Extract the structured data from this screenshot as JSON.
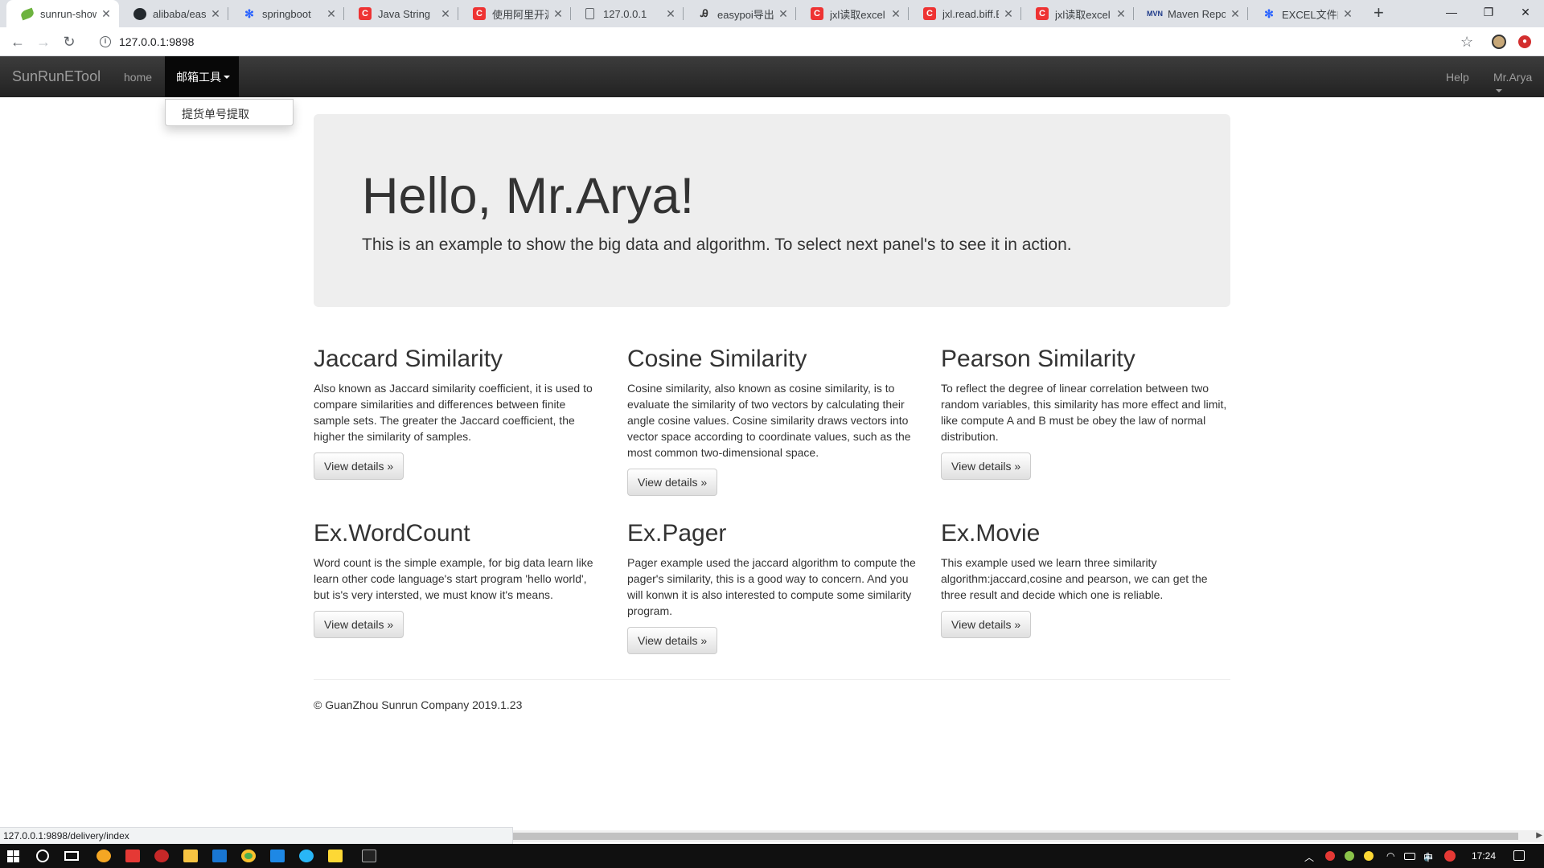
{
  "browser": {
    "tabs": [
      {
        "title": "sunrun-show",
        "icon": "spring-leaf-icon",
        "active": true
      },
      {
        "title": "alibaba/easy",
        "icon": "github-icon"
      },
      {
        "title": "springboot",
        "icon": "baidu-paw-icon"
      },
      {
        "title": "Java String",
        "icon": "csdn-icon"
      },
      {
        "title": "使用阿里开源",
        "icon": "csdn-icon"
      },
      {
        "title": "127.0.0.1",
        "icon": "document-icon"
      },
      {
        "title": "easypoi导出",
        "icon": "jianshu-icon"
      },
      {
        "title": "jxl读取excel",
        "icon": "csdn-icon"
      },
      {
        "title": "jxl.read.biff.B",
        "icon": "csdn-icon"
      },
      {
        "title": "jxl读取excel",
        "icon": "csdn-icon"
      },
      {
        "title": "Maven Repo",
        "icon": "maven-icon"
      },
      {
        "title": "EXCEL文件的",
        "icon": "baidu-paw-icon"
      }
    ],
    "url": "127.0.0.1:9898",
    "status_url": "127.0.0.1:9898/delivery/index"
  },
  "navbar": {
    "brand": "SunRunETool",
    "home": "home",
    "mail_tools": "邮箱工具",
    "help": "Help",
    "user": "Mr.Arya"
  },
  "dropdown": {
    "item": "提货单号提取"
  },
  "jumbotron": {
    "heading": "Hello, Mr.Arya!",
    "text": "This is an example to show the big data and algorithm. To select next panel's to see it in action."
  },
  "features": [
    {
      "title": "Jaccard Similarity",
      "text": "Also known as Jaccard similarity coefficient, it is used to compare similarities and differences between finite sample sets. The greater the Jaccard coefficient, the higher the similarity of samples.",
      "button": "View details »"
    },
    {
      "title": "Cosine Similarity",
      "text": "Cosine similarity, also known as cosine similarity, is to evaluate the similarity of two vectors by calculating their angle cosine values. Cosine similarity draws vectors into vector space according to coordinate values, such as the most common two-dimensional space.",
      "button": "View details »"
    },
    {
      "title": "Pearson Similarity",
      "text": "To reflect the degree of linear correlation between two random variables, this similarity has more effect and limit, like compute A and B must be obey the law of normal distribution.",
      "button": "View details »"
    },
    {
      "title": "Ex.WordCount",
      "text": "Word count is the simple example, for big data learn like learn other code language's start program 'hello world', but is's very intersted, we must know it's means.",
      "button": "View details »"
    },
    {
      "title": "Ex.Pager",
      "text": "Pager example used the jaccard algorithm to compute the pager's similarity, this is a good way to concern. And you will konwn it is also interested to compute some similarity program.",
      "button": "View details »"
    },
    {
      "title": "Ex.Movie",
      "text": "This example used we learn three similarity algorithm:jaccard,cosine and pearson, we can get the three result and decide which one is reliable.",
      "button": "View details »"
    }
  ],
  "footer": "© GuanZhou Sunrun Company 2019.1.23",
  "taskbar": {
    "time": "17:24",
    "ime": "中"
  }
}
